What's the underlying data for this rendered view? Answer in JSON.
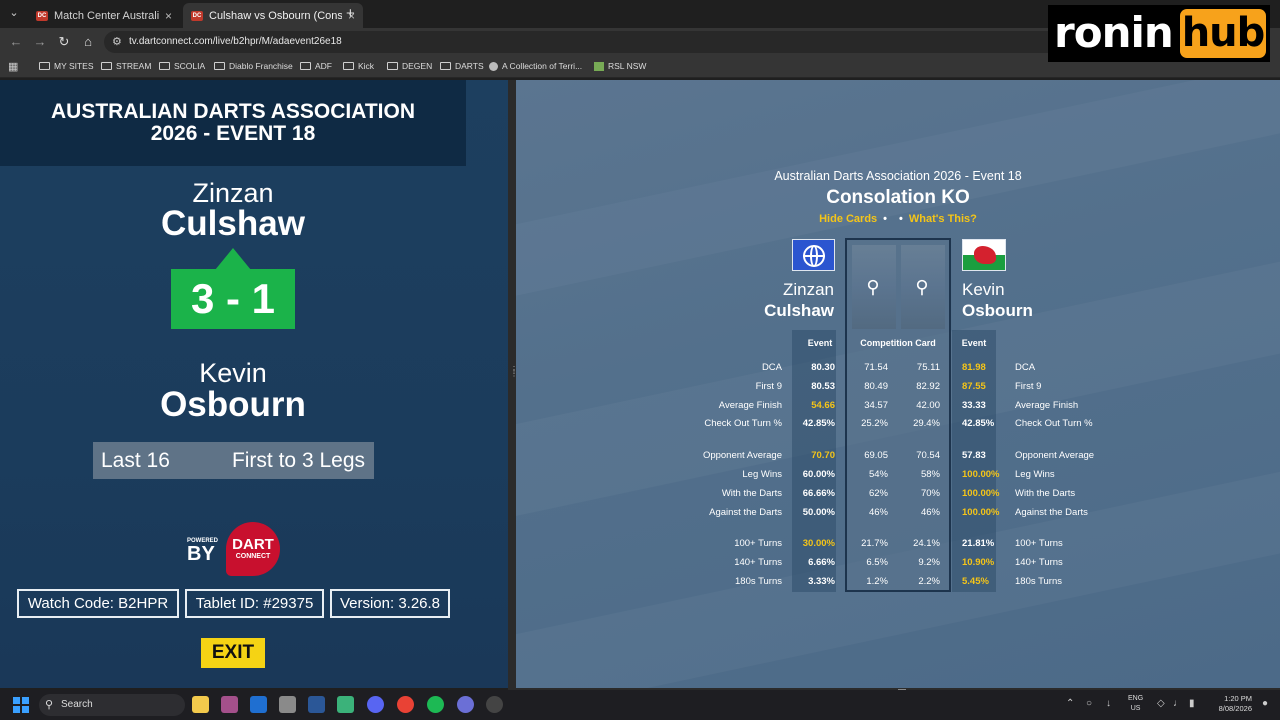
{
  "browser": {
    "tabs": [
      {
        "label": "Match Center Australian Darts A",
        "active": false
      },
      {
        "label": "Culshaw vs Osbourn (Consolatio",
        "active": true
      }
    ],
    "url": "tv.dartconnect.com/live/b2hpr/M/adaevent26e18",
    "bookmarks": [
      "MY SITES",
      "STREAM",
      "SCOLIA",
      "Diablo Franchise",
      "ADF",
      "Kick",
      "DEGEN",
      "DARTS",
      "A Collection of Terri...",
      "RSL NSW"
    ]
  },
  "overlay_logo": {
    "part1": "ronin",
    "part2": "hub"
  },
  "left": {
    "title_line1": "AUSTRALIAN DARTS ASSOCIATION",
    "title_line2": "2026 - EVENT 18",
    "player1_first": "Zinzan",
    "player1_last": "Culshaw",
    "score": "3 - 1",
    "player2_first": "Kevin",
    "player2_last": "Osbourn",
    "round": "Last 16",
    "format": "First to 3 Legs",
    "powered_small": "POWERED",
    "powered_by": "BY",
    "dc_logo_main": "DART",
    "dc_logo_sub": "CONNECT",
    "watch_code": "Watch Code: B2HPR",
    "tablet_id": "Tablet ID: #29375",
    "version": "Version: 3.26.8",
    "exit_label": "EXIT"
  },
  "right": {
    "event_title": "Australian Darts Association 2026 - Event 18",
    "match_type": "Consolation KO",
    "link_hide_cards": "Hide Cards",
    "link_whats_this": "What's This?",
    "player1_first": "Zinzan",
    "player1_last": "Culshaw",
    "player2_first": "Kevin",
    "player2_last": "Osbourn",
    "headers": {
      "event1": "Event",
      "comp": "Competition Card",
      "event2": "Event"
    },
    "highlight_color": "#f5c518",
    "stats": [
      {
        "label": "DCA",
        "e1": "80.30",
        "c1": "71.54",
        "c2": "75.11",
        "e2": "81.98",
        "hl": "e2"
      },
      {
        "label": "First 9",
        "e1": "80.53",
        "c1": "80.49",
        "c2": "82.92",
        "e2": "87.55",
        "hl": "e2"
      },
      {
        "label": "Average Finish",
        "e1": "54.66",
        "c1": "34.57",
        "c2": "42.00",
        "e2": "33.33",
        "hl": "e1"
      },
      {
        "label": "Check Out Turn %",
        "e1": "42.85%",
        "c1": "25.2%",
        "c2": "29.4%",
        "e2": "42.85%",
        "hl": ""
      },
      {
        "label": "Opponent Average",
        "e1": "70.70",
        "c1": "69.05",
        "c2": "70.54",
        "e2": "57.83",
        "hl": "e1"
      },
      {
        "label": "Leg Wins",
        "e1": "60.00%",
        "c1": "54%",
        "c2": "58%",
        "e2": "100.00%",
        "hl": "e2"
      },
      {
        "label": "With the Darts",
        "e1": "66.66%",
        "c1": "62%",
        "c2": "70%",
        "e2": "100.00%",
        "hl": "e2"
      },
      {
        "label": "Against the Darts",
        "e1": "50.00%",
        "c1": "46%",
        "c2": "46%",
        "e2": "100.00%",
        "hl": "e2"
      },
      {
        "label": "100+ Turns",
        "e1": "30.00%",
        "c1": "21.7%",
        "c2": "24.1%",
        "e2": "21.81%",
        "hl": "e1"
      },
      {
        "label": "140+ Turns",
        "e1": "6.66%",
        "c1": "6.5%",
        "c2": "9.2%",
        "e2": "10.90%",
        "hl": "e2"
      },
      {
        "label": "180s Turns",
        "e1": "3.33%",
        "c1": "1.2%",
        "c2": "2.2%",
        "e2": "5.45%",
        "hl": "e2"
      }
    ]
  },
  "taskbar": {
    "search_label": "Search",
    "lang_line1": "ENG",
    "lang_line2": "US",
    "time": "1:20 PM",
    "date": "8/08/2026"
  }
}
